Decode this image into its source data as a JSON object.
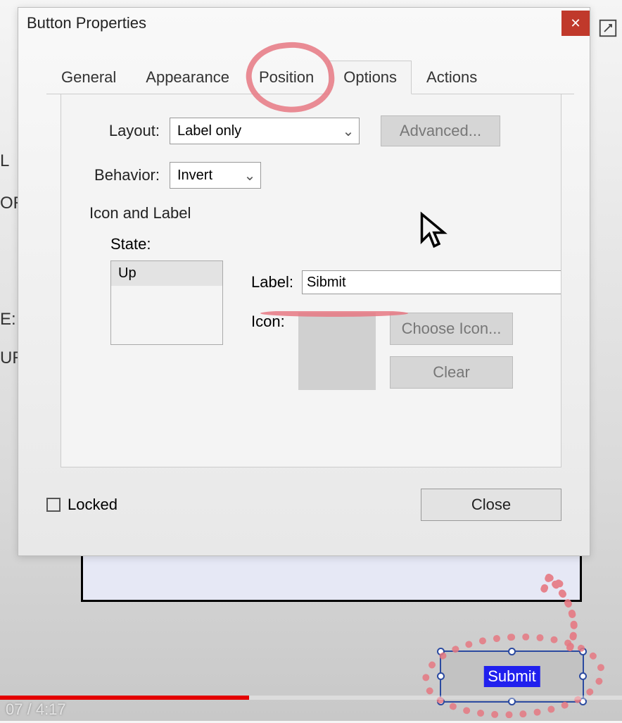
{
  "background_fragments": {
    "f1": "L",
    "f2": "OR",
    "f3": "E:",
    "f4": "UR"
  },
  "dialog": {
    "title": "Button Properties",
    "tabs": {
      "t0": "General",
      "t1": "Appearance",
      "t2": "Position",
      "t3": "Options",
      "t4": "Actions",
      "active": 3
    },
    "layout_label": "Layout:",
    "layout_value": "Label only",
    "advanced": "Advanced...",
    "behavior_label": "Behavior:",
    "behavior_value": "Invert",
    "section": "Icon and Label",
    "state_label": "State:",
    "state_value": "Up",
    "label_label": "Label:",
    "label_value": "Sibmit",
    "icon_label": "Icon:",
    "choose_icon": "Choose Icon...",
    "clear": "Clear",
    "locked_label": "Locked",
    "locked_checked": false,
    "close": "Close"
  },
  "form_button_text": "Submit",
  "video": {
    "elapsed": "07",
    "total": "4:17",
    "progress_pct": 40
  }
}
